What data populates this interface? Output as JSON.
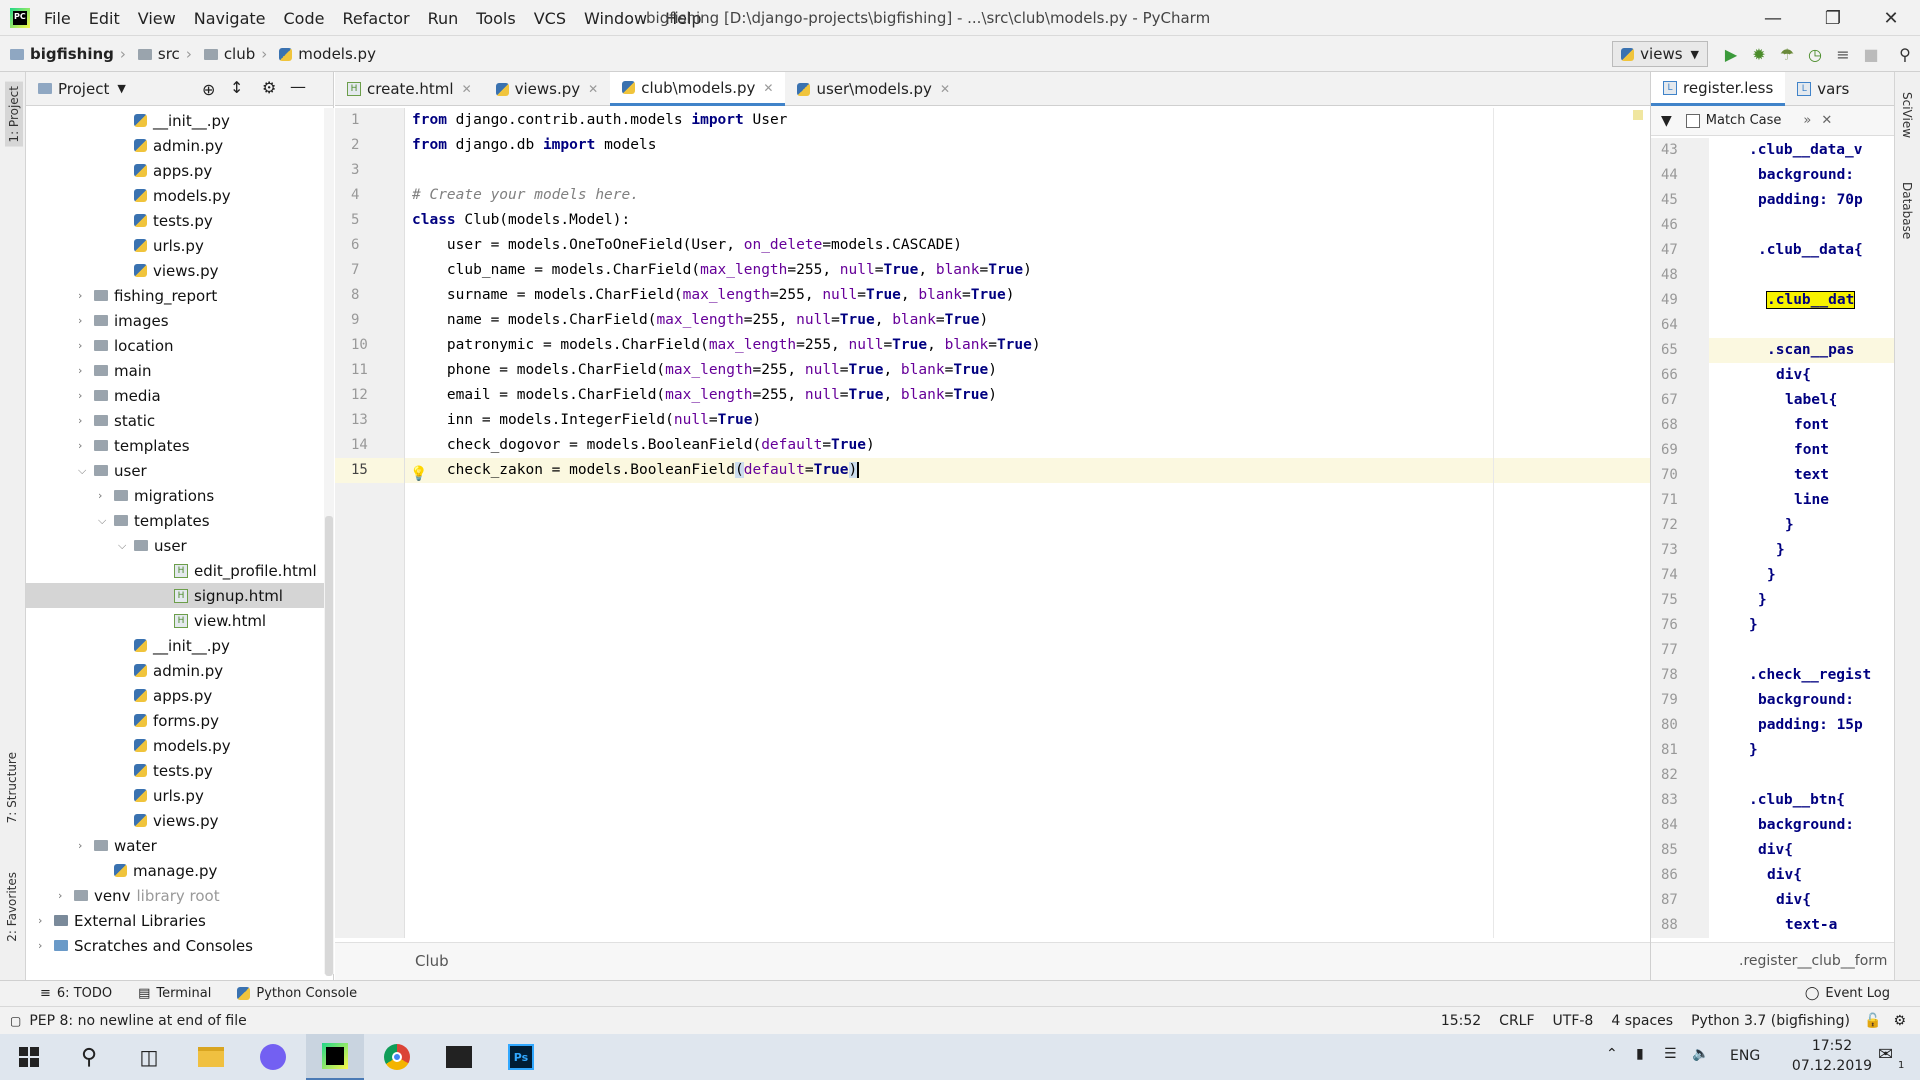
{
  "titlebar": {
    "menu": [
      "File",
      "Edit",
      "View",
      "Navigate",
      "Code",
      "Refactor",
      "Run",
      "Tools",
      "VCS",
      "Window",
      "Help"
    ],
    "title": "bigfishing [D:\\django-projects\\bigfishing] - ...\\src\\club\\models.py - PyCharm"
  },
  "navbar": {
    "crumbs": [
      "bigfishing",
      "src",
      "club",
      "models.py"
    ],
    "run_config": "views"
  },
  "project": {
    "header": "Project",
    "tree": [
      {
        "label": "__init__.py",
        "indent": 5,
        "type": "py"
      },
      {
        "label": "admin.py",
        "indent": 5,
        "type": "py"
      },
      {
        "label": "apps.py",
        "indent": 5,
        "type": "py"
      },
      {
        "label": "models.py",
        "indent": 5,
        "type": "py"
      },
      {
        "label": "tests.py",
        "indent": 5,
        "type": "py"
      },
      {
        "label": "urls.py",
        "indent": 5,
        "type": "py"
      },
      {
        "label": "views.py",
        "indent": 5,
        "type": "py"
      },
      {
        "label": "fishing_report",
        "indent": 3,
        "type": "folder",
        "arrow": "›"
      },
      {
        "label": "images",
        "indent": 3,
        "type": "folder",
        "arrow": "›"
      },
      {
        "label": "location",
        "indent": 3,
        "type": "folder",
        "arrow": "›"
      },
      {
        "label": "main",
        "indent": 3,
        "type": "folder",
        "arrow": "›"
      },
      {
        "label": "media",
        "indent": 3,
        "type": "folder",
        "arrow": "›"
      },
      {
        "label": "static",
        "indent": 3,
        "type": "folder",
        "arrow": "›"
      },
      {
        "label": "templates",
        "indent": 3,
        "type": "folder",
        "arrow": "›"
      },
      {
        "label": "user",
        "indent": 3,
        "type": "folder",
        "arrow": "⌄"
      },
      {
        "label": "migrations",
        "indent": 4,
        "type": "folder",
        "arrow": "›"
      },
      {
        "label": "templates",
        "indent": 4,
        "type": "folder",
        "arrow": "⌄"
      },
      {
        "label": "user",
        "indent": 5,
        "type": "folder",
        "arrow": "⌄"
      },
      {
        "label": "edit_profile.html",
        "indent": 7,
        "type": "html"
      },
      {
        "label": "signup.html",
        "indent": 7,
        "type": "html",
        "selected": true
      },
      {
        "label": "view.html",
        "indent": 7,
        "type": "html"
      },
      {
        "label": "__init__.py",
        "indent": 5,
        "type": "py"
      },
      {
        "label": "admin.py",
        "indent": 5,
        "type": "py"
      },
      {
        "label": "apps.py",
        "indent": 5,
        "type": "py"
      },
      {
        "label": "forms.py",
        "indent": 5,
        "type": "py"
      },
      {
        "label": "models.py",
        "indent": 5,
        "type": "py"
      },
      {
        "label": "tests.py",
        "indent": 5,
        "type": "py"
      },
      {
        "label": "urls.py",
        "indent": 5,
        "type": "py"
      },
      {
        "label": "views.py",
        "indent": 5,
        "type": "py"
      },
      {
        "label": "water",
        "indent": 3,
        "type": "folder",
        "arrow": "›"
      },
      {
        "label": "manage.py",
        "indent": 4,
        "type": "py"
      },
      {
        "label": "venv",
        "indent": 2,
        "type": "folder",
        "arrow": "›",
        "suffix": "library root"
      },
      {
        "label": "External Libraries",
        "indent": 1,
        "type": "lib",
        "arrow": "›"
      },
      {
        "label": "Scratches and Consoles",
        "indent": 1,
        "type": "scratch",
        "arrow": "›"
      }
    ]
  },
  "editor": {
    "tabs": [
      {
        "label": "create.html",
        "type": "html"
      },
      {
        "label": "views.py",
        "type": "py"
      },
      {
        "label": "club\\models.py",
        "type": "py",
        "active": true
      },
      {
        "label": "user\\models.py",
        "type": "py"
      }
    ],
    "line_numbers": [
      "1",
      "2",
      "3",
      "4",
      "5",
      "6",
      "7",
      "8",
      "9",
      "10",
      "11",
      "12",
      "13",
      "14",
      "15"
    ],
    "footer_crumb": "Club"
  },
  "right_panel": {
    "tabs": [
      "register.less",
      "vars"
    ],
    "match_case": "Match Case",
    "line_numbers": [
      "43",
      "44",
      "45",
      "46",
      "47",
      "48",
      "49",
      "64",
      "65",
      "66",
      "67",
      "68",
      "69",
      "70",
      "71",
      "72",
      "73",
      "74",
      "75",
      "76",
      "77",
      "78",
      "79",
      "80",
      "81",
      "82",
      "83",
      "84",
      "85",
      "86",
      "87",
      "88"
    ],
    "lines": [
      ".club__data_v",
      "background:",
      "padding: 70p",
      "",
      ".club__data{",
      "",
      ".club__dat",
      "",
      ".scan__pas",
      "div{",
      "label{",
      "font",
      "font",
      "text",
      "line",
      "}",
      "}",
      "}",
      "}",
      "}",
      "",
      ".check__regist",
      "background:",
      "padding: 15p",
      "}",
      "",
      ".club__btn{",
      "background:",
      "div{",
      "div{",
      "div{",
      "text-a"
    ],
    "footer_crumb": ".register__club__form"
  },
  "left_strip": [
    "1: Project",
    "7: Structure",
    "2: Favorites"
  ],
  "right_strip": [
    "SciView",
    "Database"
  ],
  "bottom_tools": [
    "6: TODO",
    "Terminal",
    "Python Console"
  ],
  "event_log": "Event Log",
  "status": {
    "message": "PEP 8: no newline at end of file",
    "position": "15:52",
    "line_sep": "CRLF",
    "encoding": "UTF-8",
    "indent": "4 spaces",
    "interpreter": "Python 3.7 (bigfishing)"
  },
  "taskbar": {
    "lang": "ENG",
    "time": "17:52",
    "date": "07.12.2019",
    "notif": "1"
  }
}
